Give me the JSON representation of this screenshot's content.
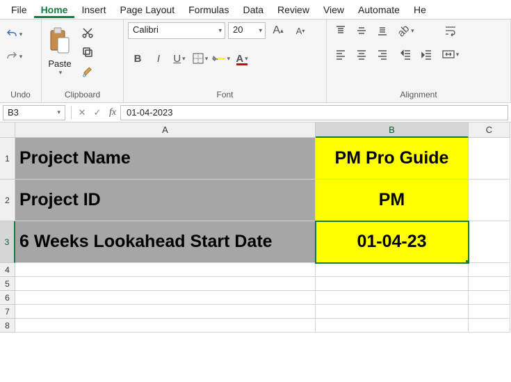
{
  "menu": {
    "file": "File",
    "home": "Home",
    "insert": "Insert",
    "pagelayout": "Page Layout",
    "formulas": "Formulas",
    "data": "Data",
    "review": "Review",
    "view": "View",
    "automate": "Automate",
    "help": "He"
  },
  "ribbon": {
    "undo_label": "Undo",
    "clipboard_label": "Clipboard",
    "paste_label": "Paste",
    "font_label": "Font",
    "font_name": "Calibri",
    "font_size": "20",
    "alignment_label": "Alignment"
  },
  "formula_bar": {
    "name_box": "B3",
    "value": "01-04-2023"
  },
  "columns": {
    "A": "A",
    "B": "B",
    "C": "C"
  },
  "rows": {
    "r1": "1",
    "r2": "2",
    "r3": "3",
    "r4": "4",
    "r5": "5",
    "r6": "6",
    "r7": "7",
    "r8": "8"
  },
  "cells": {
    "A1": "Project Name",
    "B1": "PM Pro Guide",
    "A2": "Project ID",
    "B2": "PM",
    "A3": "6 Weeks Lookahead Start Date",
    "B3": "01-04-23"
  }
}
